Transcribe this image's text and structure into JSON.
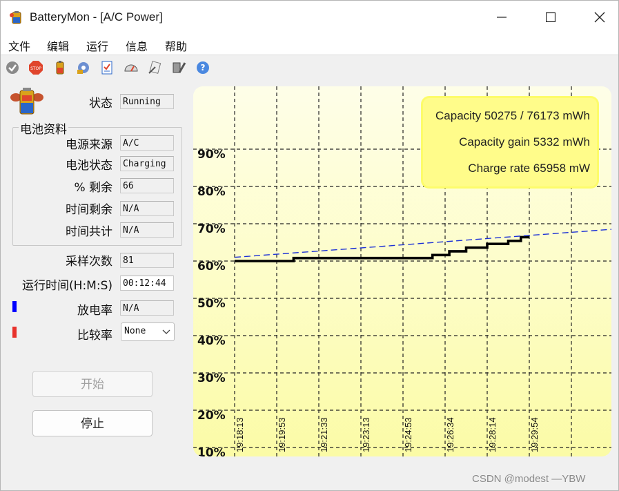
{
  "window": {
    "title": "BatteryMon - [A/C Power]"
  },
  "menu": [
    "文件",
    "编辑",
    "运行",
    "信息",
    "帮助"
  ],
  "toolbar_icons": [
    "check-icon",
    "stop-icon",
    "battery-icon",
    "gear-icon",
    "checklist-icon",
    "gauge-icon",
    "script-icon",
    "tools-icon",
    "help-icon"
  ],
  "status": {
    "label": "状态",
    "value": "Running"
  },
  "battery_info": {
    "title": "电池资料",
    "power_source": {
      "label": "电源来源",
      "value": "A/C"
    },
    "battery_state": {
      "label": "电池状态",
      "value": "Charging"
    },
    "percent_left": {
      "label": "% 剩余",
      "value": "66"
    },
    "time_left": {
      "label": "时间剩余",
      "value": "N/A"
    },
    "time_total": {
      "label": "时间共计",
      "value": "N/A"
    }
  },
  "sample_count": {
    "label": "采样次数",
    "value": "81"
  },
  "run_time": {
    "label": "运行时间(H:M:S)",
    "value": "00:12:44"
  },
  "discharge_rate": {
    "label": "放电率",
    "value": "N/A",
    "color": "#0000ff"
  },
  "compare_rate": {
    "label": "比较率",
    "value": "None",
    "color": "#e8322b"
  },
  "buttons": {
    "start": "开始",
    "stop": "停止"
  },
  "chart_data": {
    "type": "line",
    "x": [
      "19:18:13",
      "19:19:53",
      "19:21:33",
      "19:23:13",
      "19:24:53",
      "19:26:34",
      "19:28:14",
      "19:29:54"
    ],
    "y_ticks": [
      "10%",
      "20%",
      "30%",
      "40%",
      "50%",
      "60%",
      "70%",
      "80%",
      "90%"
    ],
    "ylim": [
      5,
      105
    ],
    "grid": true,
    "info_box": {
      "capacity": "Capacity 50275 / 76173 mWh",
      "capacity_gain": "Capacity gain 5332 mWh",
      "charge_rate": "Charge rate 65958 mW"
    },
    "series": [
      {
        "color": "#000000",
        "points": [
          [
            0,
            60
          ],
          [
            1.4,
            60
          ],
          [
            1.4,
            60.8
          ],
          [
            4.7,
            60.8
          ],
          [
            4.7,
            61.6
          ],
          [
            5.1,
            61.6
          ],
          [
            5.1,
            62.6
          ],
          [
            5.5,
            62.6
          ],
          [
            5.5,
            63.6
          ],
          [
            6.0,
            63.6
          ],
          [
            6.0,
            64.6
          ],
          [
            6.5,
            64.6
          ],
          [
            6.5,
            65.4
          ],
          [
            6.8,
            65.4
          ],
          [
            6.8,
            66.4
          ],
          [
            7.0,
            66.4
          ]
        ]
      },
      {
        "color": "#1a2fd6",
        "dashed": true,
        "points": [
          [
            0,
            61.0
          ],
          [
            9.3,
            68.8
          ]
        ]
      }
    ]
  },
  "watermark": "CSDN @modest —YBW"
}
